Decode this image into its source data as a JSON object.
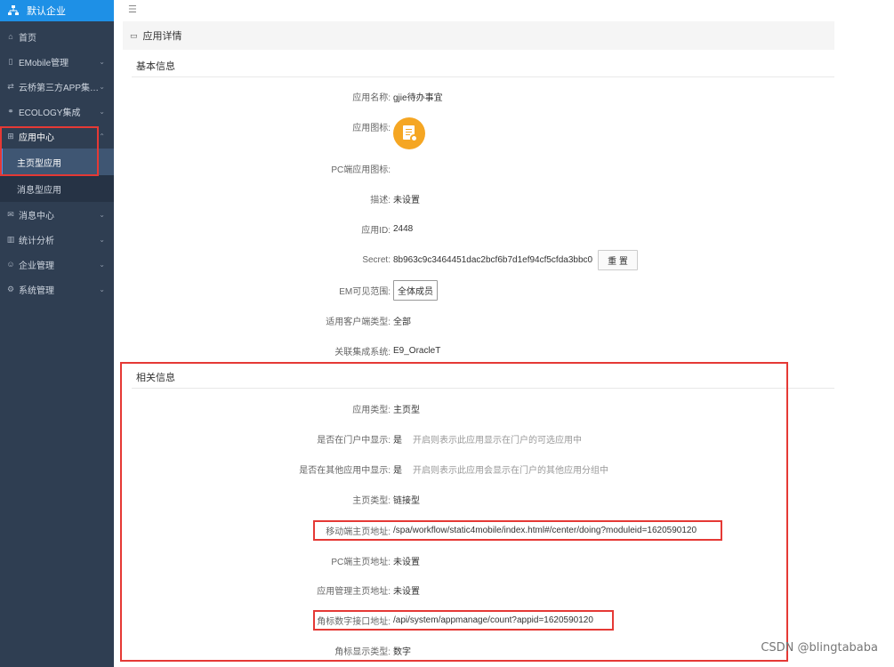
{
  "brand": {
    "title": "默认企业"
  },
  "sidebar": {
    "items": [
      {
        "label": "首页",
        "icon": "home-icon",
        "glyph": "⌂",
        "chevron": ""
      },
      {
        "label": "EMobile管理",
        "icon": "phone-icon",
        "glyph": "▯",
        "chevron": "⌄"
      },
      {
        "label": "云桥第三方APP集…",
        "icon": "link-icon",
        "glyph": "⇄",
        "chevron": "⌄"
      },
      {
        "label": "ECOLOGY集成",
        "icon": "chain-icon",
        "glyph": "⚭",
        "chevron": "⌄"
      },
      {
        "label": "应用中心",
        "icon": "grid-icon",
        "glyph": "⊞",
        "chevron": "⌃"
      }
    ],
    "sub_items": [
      {
        "label": "主页型应用"
      },
      {
        "label": "消息型应用"
      }
    ],
    "items_after": [
      {
        "label": "消息中心",
        "icon": "mail-icon",
        "glyph": "✉",
        "chevron": "⌄"
      },
      {
        "label": "统计分析",
        "icon": "chart-icon",
        "glyph": "▥",
        "chevron": "⌄"
      },
      {
        "label": "企业管理",
        "icon": "user-icon",
        "glyph": "☺",
        "chevron": "⌄"
      },
      {
        "label": "系统管理",
        "icon": "gear-icon",
        "glyph": "⚙",
        "chevron": "⌄"
      }
    ]
  },
  "topbar": {
    "menu_icon": "☰"
  },
  "panel": {
    "title": "应用详情",
    "icon": "▭"
  },
  "basic": {
    "section_title": "基本信息",
    "app_name_label": "应用名称:",
    "app_name": "gjie待办事宜",
    "app_icon_label": "应用图标:",
    "pc_icon_label": "PC端应用图标:",
    "desc_label": "描述:",
    "desc": "未设置",
    "app_id_label": "应用ID:",
    "app_id": "2448",
    "secret_label": "Secret:",
    "secret": "8b963c9c3464451dac2bcf6b7d1ef94cf5cfda3bbc0",
    "reset_button": "重 置",
    "em_scope_label": "EM可见范围:",
    "em_scope": "全体成员",
    "client_type_label": "适用客户端类型:",
    "client_type": "全部",
    "integration_label": "关联集成系统:",
    "integration": "E9_OracleT"
  },
  "related": {
    "section_title": "相关信息",
    "app_type_label": "应用类型:",
    "app_type": "主页型",
    "show_portal_label": "是否在门户中显示:",
    "show_portal": "是",
    "show_portal_hint": "开启则表示此应用显示在门户的可选应用中",
    "show_other_label": "是否在其他应用中显示:",
    "show_other": "是",
    "show_other_hint": "开启则表示此应用会显示在门户的其他应用分组中",
    "home_type_label": "主页类型:",
    "home_type": "链接型",
    "mobile_url_label": "移动端主页地址:",
    "mobile_url": "/spa/workflow/static4mobile/index.html#/center/doing?moduleid=1620590120",
    "pc_url_label": "PC端主页地址:",
    "pc_url": "未设置",
    "admin_url_label": "应用管理主页地址:",
    "admin_url": "未设置",
    "badge_api_label": "角标数字接口地址:",
    "badge_api": "/api/system/appmanage/count?appid=1620590120",
    "badge_type_label": "角标显示类型:",
    "badge_type": "数字"
  },
  "watermark": "CSDN @blingtababa",
  "colors": {
    "sidebar": "#2f3e52",
    "brand": "#1e90e6",
    "highlight": "#e53935",
    "app_icon": "#f5a623"
  }
}
